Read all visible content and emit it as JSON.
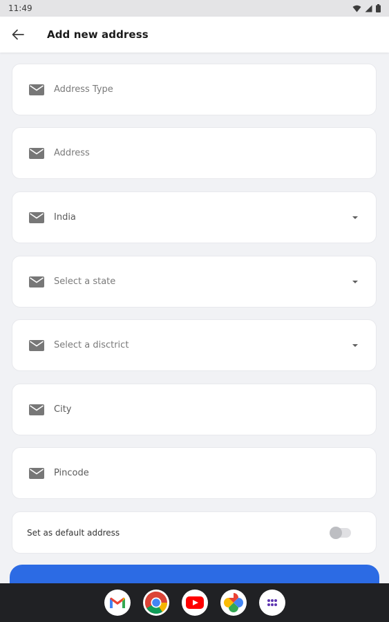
{
  "status_bar": {
    "time": "11:49"
  },
  "app_bar": {
    "title": "Add new address"
  },
  "form": {
    "fields": [
      {
        "label": "Address Type",
        "dropdown": false
      },
      {
        "label": "Address",
        "dropdown": false
      },
      {
        "label": "India",
        "dropdown": true
      },
      {
        "label": "Select a state",
        "dropdown": true
      },
      {
        "label": "Select a disctrict",
        "dropdown": true
      },
      {
        "label": "City",
        "dropdown": false
      },
      {
        "label": "Pincode",
        "dropdown": false
      }
    ],
    "default_address": {
      "label": "Set as default address",
      "enabled": false
    }
  },
  "dock": {
    "apps": [
      "gmail-icon",
      "chrome-icon",
      "youtube-icon",
      "photos-icon",
      "app-drawer-icon"
    ]
  },
  "colors": {
    "accent": "#2c6be4",
    "background": "#f1f2f5",
    "card": "#ffffff"
  }
}
